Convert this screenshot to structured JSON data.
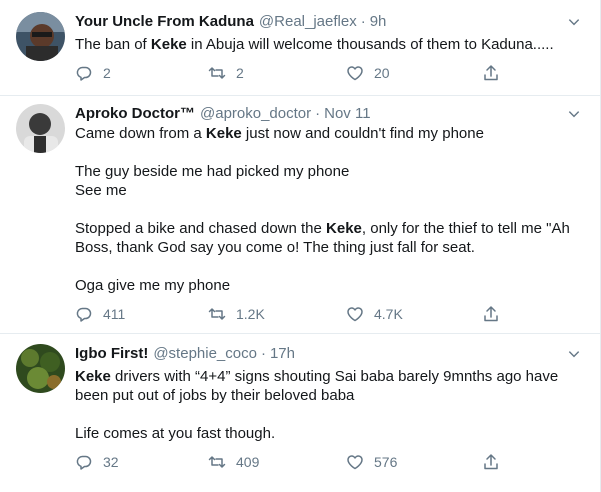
{
  "tweets": [
    {
      "author_name": "Your Uncle From Kaduna",
      "handle": "@Real_jaeflex",
      "separator": "·",
      "time": "9h",
      "lines": [
        [
          {
            "t": "The ban of "
          },
          {
            "t": "Keke",
            "b": true
          },
          {
            "t": " in Abuja will welcome thousands of them to Kaduna....."
          }
        ]
      ],
      "replies": "2",
      "retweets": "2",
      "likes": "20"
    },
    {
      "author_name": "Aproko Doctor™",
      "handle": "@aproko_doctor",
      "separator": "·",
      "time": "Nov 11",
      "lines": [
        [
          {
            "t": "Came down from a "
          },
          {
            "t": "Keke",
            "b": true
          },
          {
            "t": " just now and couldn't find my phone"
          }
        ],
        [],
        [
          {
            "t": "The guy beside me had picked my phone"
          }
        ],
        [
          {
            "t": "See me"
          }
        ],
        [],
        [
          {
            "t": "Stopped a bike and chased down the "
          },
          {
            "t": "Keke",
            "b": true
          },
          {
            "t": ", only for the thief to tell me \"Ah"
          }
        ],
        [
          {
            "t": "Boss, thank God say you come o! The thing just fall for seat."
          }
        ],
        [],
        [
          {
            "t": "Oga give me my phone"
          }
        ]
      ],
      "replies": "411",
      "retweets": "1.2K",
      "likes": "4.7K"
    },
    {
      "author_name": "Igbo First!",
      "handle": "@stephie_coco",
      "separator": "·",
      "time": "17h",
      "lines": [
        [
          {
            "t": "Keke",
            "b": true
          },
          {
            "t": " drivers with “4+4” signs shouting Sai baba barely 9mnths ago have"
          }
        ],
        [
          {
            "t": "been put out of jobs by their beloved baba"
          }
        ],
        [],
        [
          {
            "t": "Life comes at you fast though."
          }
        ]
      ],
      "replies": "32",
      "retweets": "409",
      "likes": "576"
    }
  ],
  "icons": {
    "reply": "reply-icon",
    "retweet": "retweet-icon",
    "like": "heart-icon",
    "share": "share-icon",
    "menu": "chevron-down-icon"
  },
  "colors": {
    "text": "#14171a",
    "secondary": "#657786",
    "divider": "#e6ecf0"
  }
}
